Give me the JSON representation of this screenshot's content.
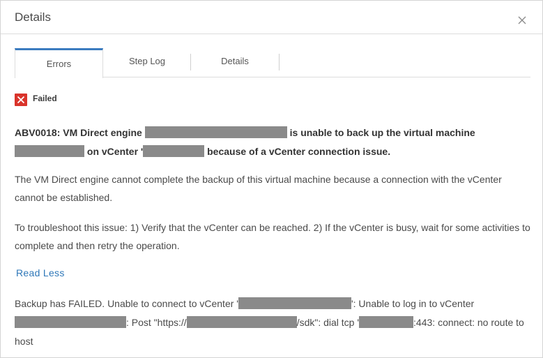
{
  "dialog": {
    "title": "Details",
    "close_icon": "close-icon"
  },
  "tabs": [
    {
      "label": "Errors",
      "active": true
    },
    {
      "label": "Step Log",
      "active": false
    },
    {
      "label": "Details",
      "active": false
    }
  ],
  "status": {
    "icon": "x-error-icon",
    "color": "#d9342b",
    "label": "Failed"
  },
  "error": {
    "headline_part1": "ABV0018: VM Direct engine",
    "headline_part2": "is unable to back up the virtual machine",
    "headline_part3": "on vCenter '",
    "headline_part4": "because of a vCenter connection issue.",
    "description": "The VM Direct engine cannot complete the backup of this virtual machine because a connection with the vCenter cannot be established.",
    "remedy": "To troubleshoot this issue: 1) Verify that the vCenter can be reached. 2) If the vCenter is busy, wait for some activities to complete and then retry the operation.",
    "toggle_label": "Read Less",
    "detail_part1": "Backup has FAILED. Unable to connect to vCenter '",
    "detail_part2": "': Unable to log in to vCenter",
    "detail_part3": ": Post \"https://",
    "detail_part4": "/sdk\": dial tcp '",
    "detail_part5": ":443: connect: no route to host"
  },
  "colors": {
    "accent": "#3b7bbf",
    "link": "#2e77b8",
    "error": "#d9342b",
    "redaction": "#8a8a8a"
  }
}
